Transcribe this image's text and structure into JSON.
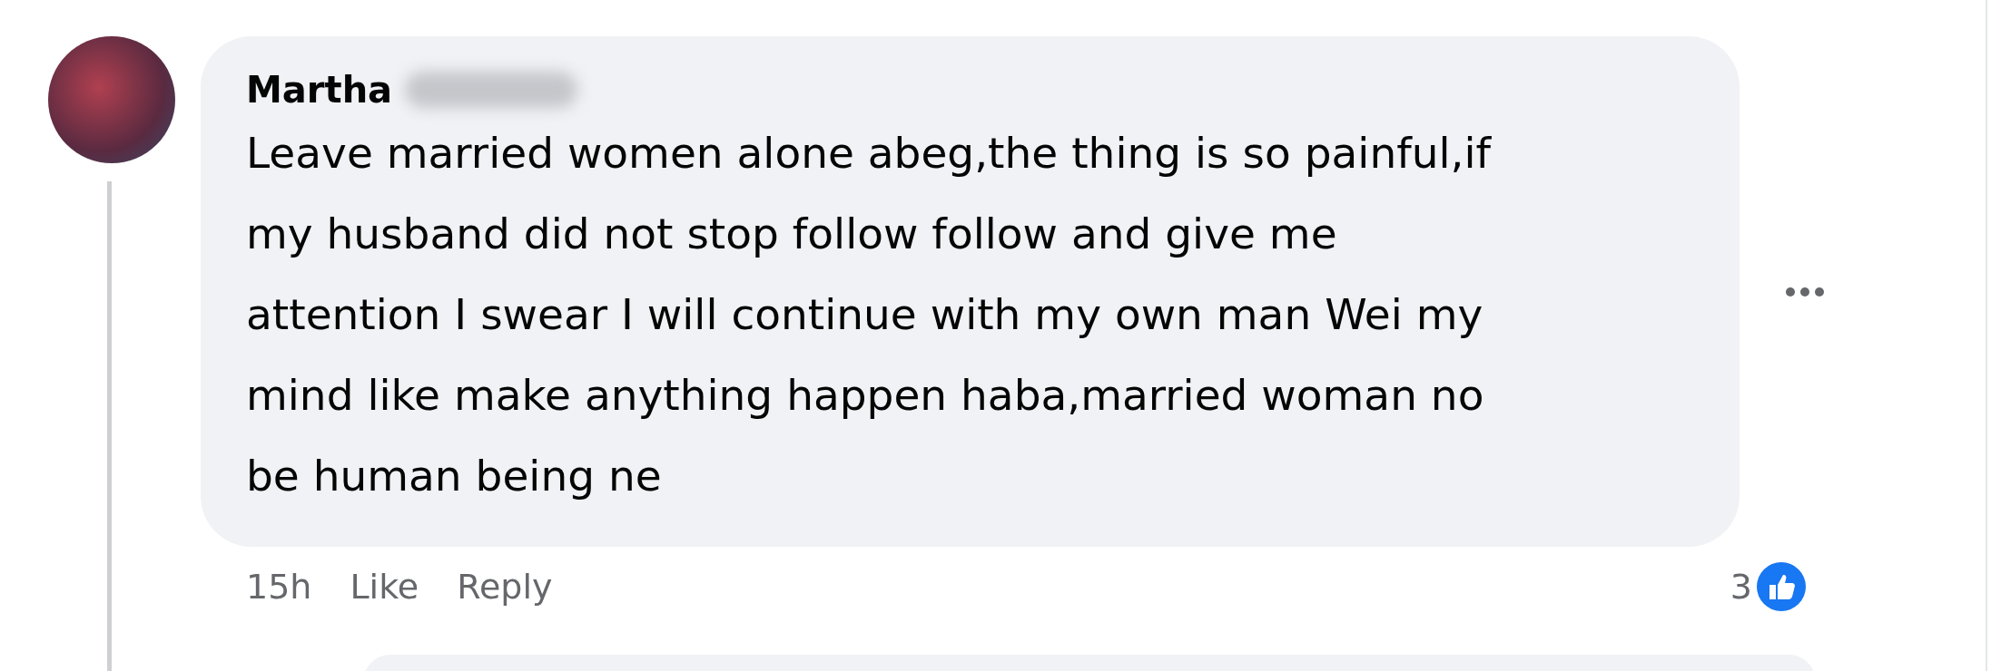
{
  "comment": {
    "author": "Martha",
    "text": "Leave married women alone abeg,the thing is so painful,if\nmy husband did not stop follow follow and give me\nattention I swear I will continue with my own man Wei my\nmind like make anything happen haba,married woman no\nbe human being ne",
    "time": "15h",
    "actions": [
      "Like",
      "Reply"
    ],
    "reaction_count": "3"
  }
}
